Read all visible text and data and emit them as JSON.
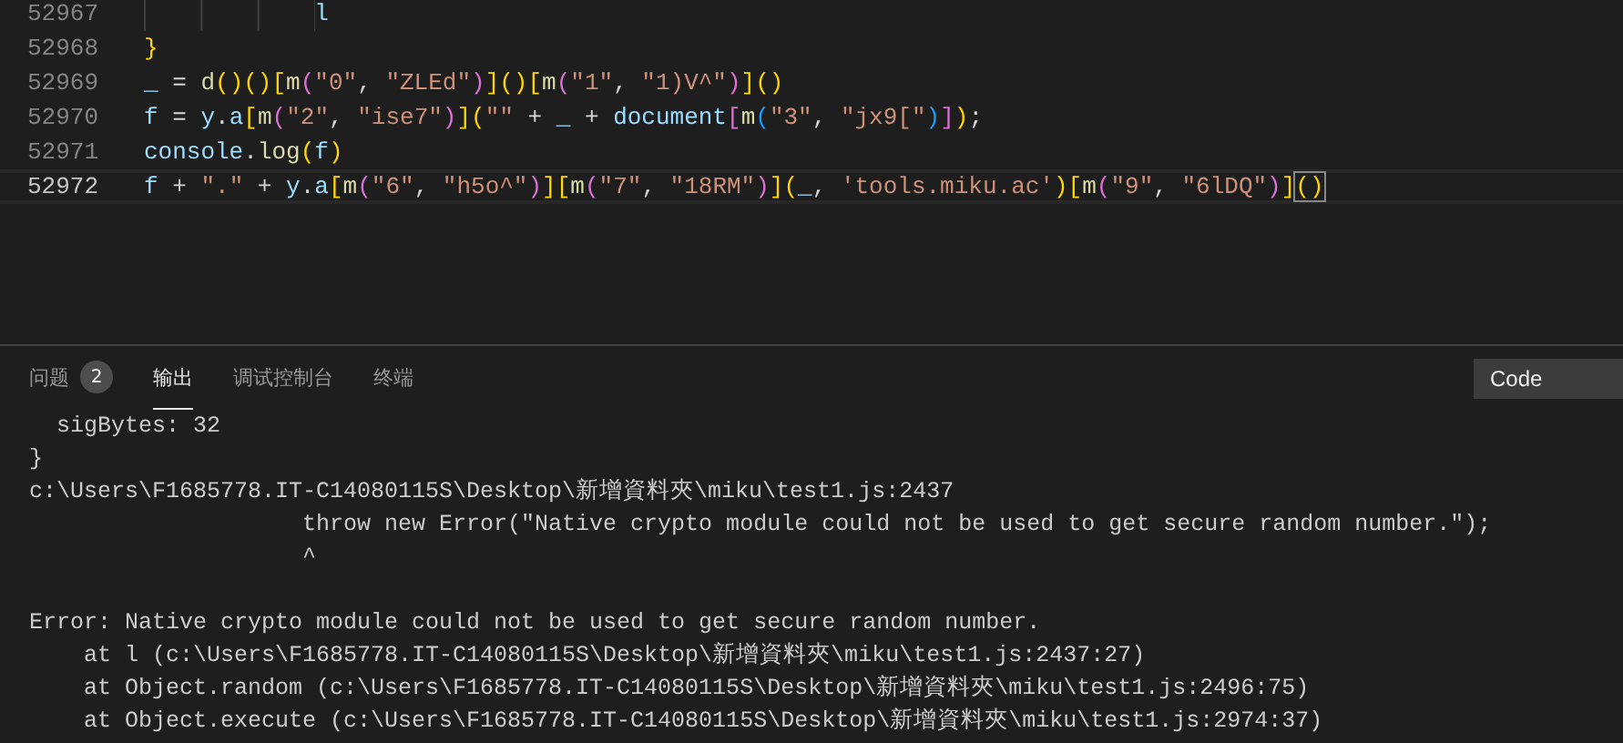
{
  "editor": {
    "lines": [
      {
        "number": "52967",
        "current": false,
        "tokens": [
          {
            "kind": "variable",
            "text": "            l"
          }
        ]
      },
      {
        "number": "52968",
        "current": false,
        "tokens": [
          {
            "kind": "bracket1",
            "text": "}"
          }
        ]
      },
      {
        "number": "52969",
        "current": false,
        "tokens": [
          {
            "kind": "variable",
            "text": "_"
          },
          {
            "kind": "plain",
            "text": " = "
          },
          {
            "kind": "function",
            "text": "d"
          },
          {
            "kind": "bracket1",
            "text": "()()["
          },
          {
            "kind": "function",
            "text": "m"
          },
          {
            "kind": "bracket2",
            "text": "("
          },
          {
            "kind": "string",
            "text": "\"0\""
          },
          {
            "kind": "plain",
            "text": ", "
          },
          {
            "kind": "string",
            "text": "\"ZLEd\""
          },
          {
            "kind": "bracket2",
            "text": ")"
          },
          {
            "kind": "bracket1",
            "text": "]()["
          },
          {
            "kind": "function",
            "text": "m"
          },
          {
            "kind": "bracket2",
            "text": "("
          },
          {
            "kind": "string",
            "text": "\"1\""
          },
          {
            "kind": "plain",
            "text": ", "
          },
          {
            "kind": "string",
            "text": "\"1)V^\""
          },
          {
            "kind": "bracket2",
            "text": ")"
          },
          {
            "kind": "bracket1",
            "text": "]()"
          }
        ]
      },
      {
        "number": "52970",
        "current": false,
        "tokens": [
          {
            "kind": "variable",
            "text": "f"
          },
          {
            "kind": "plain",
            "text": " = "
          },
          {
            "kind": "variable",
            "text": "y"
          },
          {
            "kind": "plain",
            "text": "."
          },
          {
            "kind": "variable",
            "text": "a"
          },
          {
            "kind": "bracket1",
            "text": "["
          },
          {
            "kind": "function",
            "text": "m"
          },
          {
            "kind": "bracket2",
            "text": "("
          },
          {
            "kind": "string",
            "text": "\"2\""
          },
          {
            "kind": "plain",
            "text": ", "
          },
          {
            "kind": "string",
            "text": "\"ise7\""
          },
          {
            "kind": "bracket2",
            "text": ")"
          },
          {
            "kind": "bracket1",
            "text": "]("
          },
          {
            "kind": "string",
            "text": "\"\""
          },
          {
            "kind": "plain",
            "text": " + "
          },
          {
            "kind": "variable",
            "text": "_"
          },
          {
            "kind": "plain",
            "text": " + "
          },
          {
            "kind": "variable",
            "text": "document"
          },
          {
            "kind": "bracket2",
            "text": "["
          },
          {
            "kind": "function",
            "text": "m"
          },
          {
            "kind": "bracket3",
            "text": "("
          },
          {
            "kind": "string",
            "text": "\"3\""
          },
          {
            "kind": "plain",
            "text": ", "
          },
          {
            "kind": "string",
            "text": "\"jx9[\""
          },
          {
            "kind": "bracket3",
            "text": ")"
          },
          {
            "kind": "bracket2",
            "text": "]"
          },
          {
            "kind": "bracket1",
            "text": ")"
          },
          {
            "kind": "plain",
            "text": ";"
          }
        ]
      },
      {
        "number": "52971",
        "current": false,
        "tokens": [
          {
            "kind": "variable",
            "text": "console"
          },
          {
            "kind": "plain",
            "text": "."
          },
          {
            "kind": "function",
            "text": "log"
          },
          {
            "kind": "bracket1",
            "text": "("
          },
          {
            "kind": "variable",
            "text": "f"
          },
          {
            "kind": "bracket1",
            "text": ")"
          }
        ]
      },
      {
        "number": "52972",
        "current": true,
        "tokens": [
          {
            "kind": "variable",
            "text": "f"
          },
          {
            "kind": "plain",
            "text": " + "
          },
          {
            "kind": "string",
            "text": "\".\""
          },
          {
            "kind": "plain",
            "text": " + "
          },
          {
            "kind": "variable",
            "text": "y"
          },
          {
            "kind": "plain",
            "text": "."
          },
          {
            "kind": "variable",
            "text": "a"
          },
          {
            "kind": "bracket1",
            "text": "["
          },
          {
            "kind": "function",
            "text": "m"
          },
          {
            "kind": "bracket2",
            "text": "("
          },
          {
            "kind": "string",
            "text": "\"6\""
          },
          {
            "kind": "plain",
            "text": ", "
          },
          {
            "kind": "string",
            "text": "\"h5o^\""
          },
          {
            "kind": "bracket2",
            "text": ")"
          },
          {
            "kind": "bracket1",
            "text": "]["
          },
          {
            "kind": "function",
            "text": "m"
          },
          {
            "kind": "bracket2",
            "text": "("
          },
          {
            "kind": "string",
            "text": "\"7\""
          },
          {
            "kind": "plain",
            "text": ", "
          },
          {
            "kind": "string",
            "text": "\"18RM\""
          },
          {
            "kind": "bracket2",
            "text": ")"
          },
          {
            "kind": "bracket1",
            "text": "]("
          },
          {
            "kind": "variable",
            "text": "_"
          },
          {
            "kind": "plain",
            "text": ", "
          },
          {
            "kind": "string",
            "text": "'tools.miku.ac'"
          },
          {
            "kind": "bracket1",
            "text": ")["
          },
          {
            "kind": "function",
            "text": "m"
          },
          {
            "kind": "bracket2",
            "text": "("
          },
          {
            "kind": "string",
            "text": "\"9\""
          },
          {
            "kind": "plain",
            "text": ", "
          },
          {
            "kind": "string",
            "text": "\"6lDQ\""
          },
          {
            "kind": "bracket2",
            "text": ")"
          },
          {
            "kind": "bracket1",
            "text": "]"
          },
          {
            "kind": "match",
            "text": "()"
          }
        ]
      }
    ]
  },
  "panel": {
    "tabs": [
      {
        "label": "问题",
        "badge": "2",
        "selected": false
      },
      {
        "label": "输出",
        "selected": true
      },
      {
        "label": "调试控制台",
        "selected": false
      },
      {
        "label": "终端",
        "selected": false
      }
    ],
    "channel": "Code",
    "output": [
      [
        "  sigBytes: 32",
        "}",
        "c:\\Users\\F1685778.IT-C14080115S\\Desktop\\新增資料夾\\miku\\test1.js:2437",
        "                    throw new Error(\"Native crypto module could not be used to get secure random number.\");",
        "                    ^"
      ],
      [
        "Error: Native crypto module could not be used to get secure random number.",
        "    at l (c:\\Users\\F1685778.IT-C14080115S\\Desktop\\新增資料夾\\miku\\test1.js:2437:27)",
        "    at Object.random (c:\\Users\\F1685778.IT-C14080115S\\Desktop\\新增資料夾\\miku\\test1.js:2496:75)",
        "    at Object.execute (c:\\Users\\F1685778.IT-C14080115S\\Desktop\\新增資料夾\\miku\\test1.js:2974:37)"
      ]
    ]
  }
}
